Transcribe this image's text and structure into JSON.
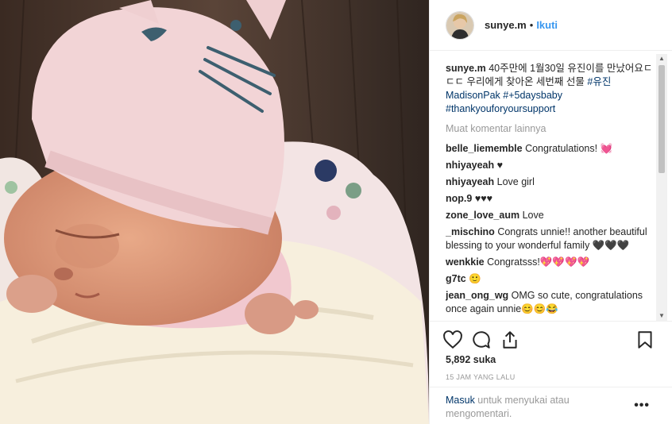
{
  "post": {
    "username": "sunye.m",
    "separator": "•",
    "follow_label": "Ikuti",
    "caption": {
      "username": "sunye.m",
      "text": "40주만에 1월30일 유진이를 만났어요ㄷㄷㄷ 우리에게 찾아온 세번째 선물",
      "hashtags": "#유진MadisonPak #+5daysbaby #thankyouforyoursupport"
    },
    "more_comments_label": "Muat komentar lainnya",
    "comments": [
      {
        "user": "belle_liememble",
        "text": "Congratulations! 💓"
      },
      {
        "user": "nhiyayeah",
        "text": "♥"
      },
      {
        "user": "nhiyayeah",
        "text": "Love girl"
      },
      {
        "user": "nop.9",
        "text": "♥♥♥"
      },
      {
        "user": "zone_love_aum",
        "text": "Love"
      },
      {
        "user": "_mischino",
        "text": "Congrats unnie!! another beautiful blessing to your wonderful family 🖤🖤🖤"
      },
      {
        "user": "wenkkie",
        "text": "Congratsss!💖💖💖💖"
      },
      {
        "user": "g7tc",
        "text": "🙂"
      },
      {
        "user": "jean_ong_wg",
        "text": "OMG so cute, congratulations once again unnie😊😊😂"
      }
    ],
    "likes": "5,892 suka",
    "timestamp": "15 JAM YANG LALU",
    "login": {
      "link": "Masuk",
      "text": " untuk menyukai atau mengomentari."
    },
    "options_label": "•••",
    "icons": {
      "like": "heart-icon",
      "comment": "comment-icon",
      "share": "share-icon",
      "save": "bookmark-icon"
    },
    "colors": {
      "link": "#3897f0",
      "hashtag": "#003569",
      "muted": "#999999"
    }
  }
}
